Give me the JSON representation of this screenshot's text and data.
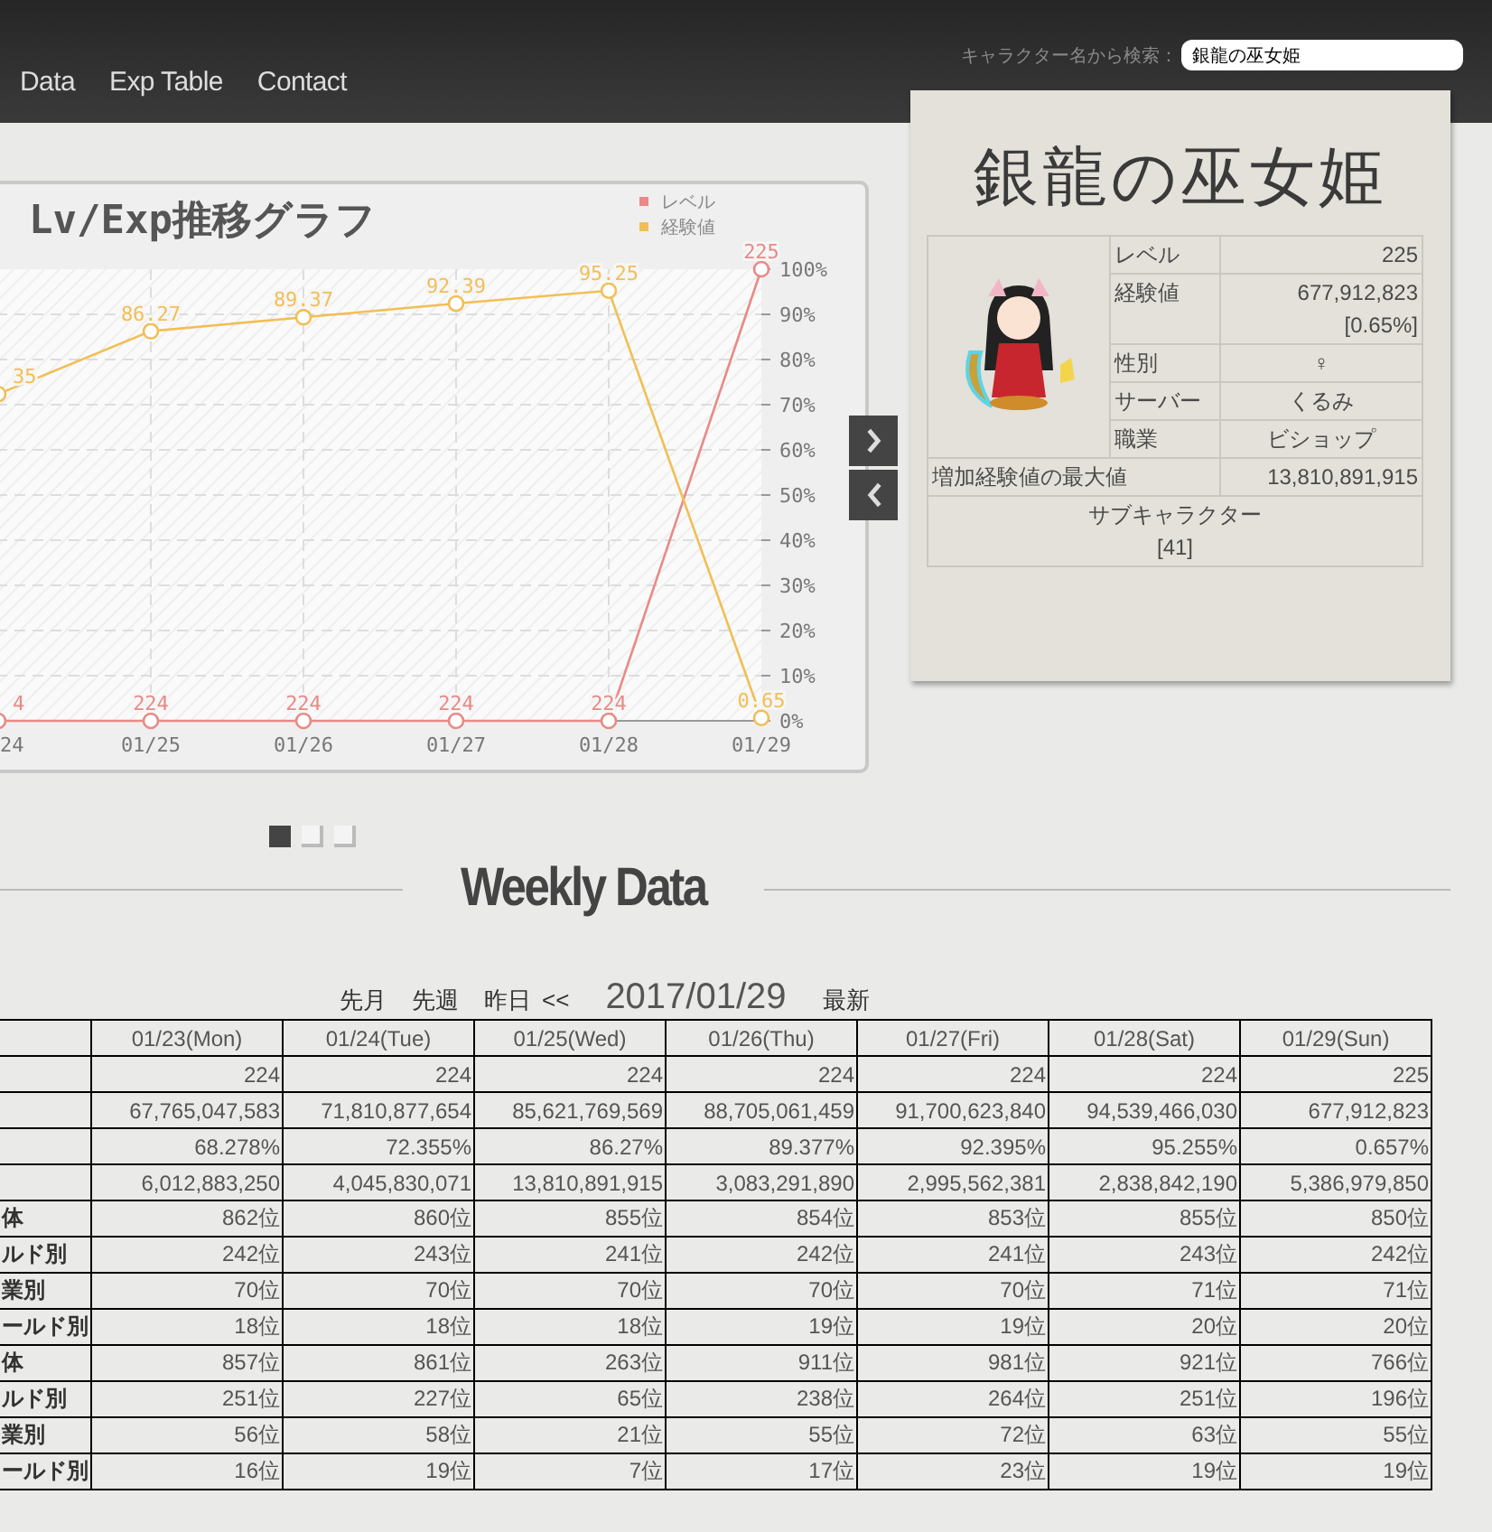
{
  "header": {
    "nav": [
      "Data",
      "Exp Table",
      "Contact"
    ],
    "search": {
      "label": "キャラクター名から検索：",
      "value": "銀龍の巫女姫"
    }
  },
  "chart": {
    "title": "Lv/Exp推移グラフ",
    "chart_data": {
      "type": "line",
      "grid": true,
      "legend": true,
      "categories": [
        "24",
        "01/25",
        "01/26",
        "01/27",
        "01/28",
        "01/29"
      ],
      "ylim": [
        0,
        100
      ],
      "yticks": [
        {
          "value": 0,
          "label": "0%"
        },
        {
          "value": 10,
          "label": "10%"
        },
        {
          "value": 20,
          "label": "20%"
        },
        {
          "value": 30,
          "label": "30%"
        },
        {
          "value": 40,
          "label": "40%"
        },
        {
          "value": 50,
          "label": "50%"
        },
        {
          "value": 60,
          "label": "60%"
        },
        {
          "value": 70,
          "label": "70%"
        },
        {
          "value": 80,
          "label": "80%"
        },
        {
          "value": 90,
          "label": "90%"
        },
        {
          "value": 100,
          "label": "100%"
        }
      ],
      "series": [
        {
          "name": "レベル",
          "color": "#e88a86",
          "marker": "circle",
          "values": [
            0,
            0,
            0,
            0,
            0,
            100
          ]
        },
        {
          "name": "経験値",
          "color": "#f2be55",
          "marker": "circle",
          "values": [
            72.35,
            86.27,
            89.37,
            92.39,
            95.25,
            0.65
          ]
        }
      ],
      "value_labels": [
        [
          "4",
          "224",
          "224",
          "224",
          "224",
          "225"
        ],
        [
          "35",
          "86.27",
          "89.37",
          "92.39",
          "95.25",
          "0.65"
        ]
      ]
    }
  },
  "pager": [
    {
      "selected": true
    },
    {
      "selected": false
    },
    {
      "selected": false
    }
  ],
  "profile": {
    "name": "銀龍の巫女姫",
    "fields": [
      {
        "label": "レベル",
        "kind": "number",
        "value": "225"
      },
      {
        "label": "経験値",
        "kind": "number",
        "value": "677,912,823",
        "note": "[0.65%]"
      },
      {
        "label": "性別",
        "kind": "text",
        "value": "♀"
      },
      {
        "label": "サーバー",
        "kind": "text",
        "value": "くるみ"
      },
      {
        "label": "職業",
        "kind": "text",
        "value": "ビショップ"
      }
    ],
    "max_gain": {
      "label": "増加経験値の最大値",
      "value": "13,810,891,915"
    },
    "sub_characters": {
      "label": "サブキャラクター",
      "value": "[41]"
    }
  },
  "weekly": {
    "title": "Weekly Data",
    "date_nav": [
      "先月",
      "先週",
      "昨日",
      "<<"
    ],
    "current_date": "2017/01/29",
    "latest": "最新",
    "columns": [
      "01/23(Mon)",
      "01/24(Tue)",
      "01/25(Wed)",
      "01/26(Thu)",
      "01/27(Fri)",
      "01/28(Sat)",
      "01/29(Sun)"
    ],
    "rows": [
      {
        "cells": [
          "224",
          "224",
          "224",
          "224",
          "224",
          "224",
          "225"
        ]
      },
      {
        "cells": [
          "67,765,047,583",
          "71,810,877,654",
          "85,621,769,569",
          "88,705,061,459",
          "91,700,623,840",
          "94,539,466,030",
          "677,912,823"
        ]
      },
      {
        "cells": [
          "68.278%",
          "72.355%",
          "86.27%",
          "89.377%",
          "92.395%",
          "95.255%",
          "0.657%"
        ]
      },
      {
        "cells": [
          "6,012,883,250",
          "4,045,830,071",
          "13,810,891,915",
          "3,083,291,890",
          "2,995,562,381",
          "2,838,842,190",
          "5,386,979,850"
        ]
      },
      {
        "label": "体",
        "cells": [
          "862位",
          "860位",
          "855位",
          "854位",
          "853位",
          "855位",
          "850位"
        ]
      },
      {
        "label": "ルド別",
        "cells": [
          "242位",
          "243位",
          "241位",
          "242位",
          "241位",
          "243位",
          "242位"
        ]
      },
      {
        "label": "業別",
        "cells": [
          "70位",
          "70位",
          "70位",
          "70位",
          "70位",
          "71位",
          "71位"
        ]
      },
      {
        "label": "ールド別",
        "cells": [
          "18位",
          "18位",
          "18位",
          "19位",
          "19位",
          "20位",
          "20位"
        ]
      },
      {
        "label": "体",
        "cells": [
          "857位",
          "861位",
          "263位",
          "911位",
          "981位",
          "921位",
          "766位"
        ]
      },
      {
        "label": "ルド別",
        "cells": [
          "251位",
          "227位",
          "65位",
          "238位",
          "264位",
          "251位",
          "196位"
        ]
      },
      {
        "label": "業別",
        "cells": [
          "56位",
          "58位",
          "21位",
          "55位",
          "72位",
          "63位",
          "55位"
        ]
      },
      {
        "label": "ールド別",
        "cells": [
          "16位",
          "19位",
          "7位",
          "17位",
          "23位",
          "19位",
          "19位"
        ]
      }
    ]
  }
}
